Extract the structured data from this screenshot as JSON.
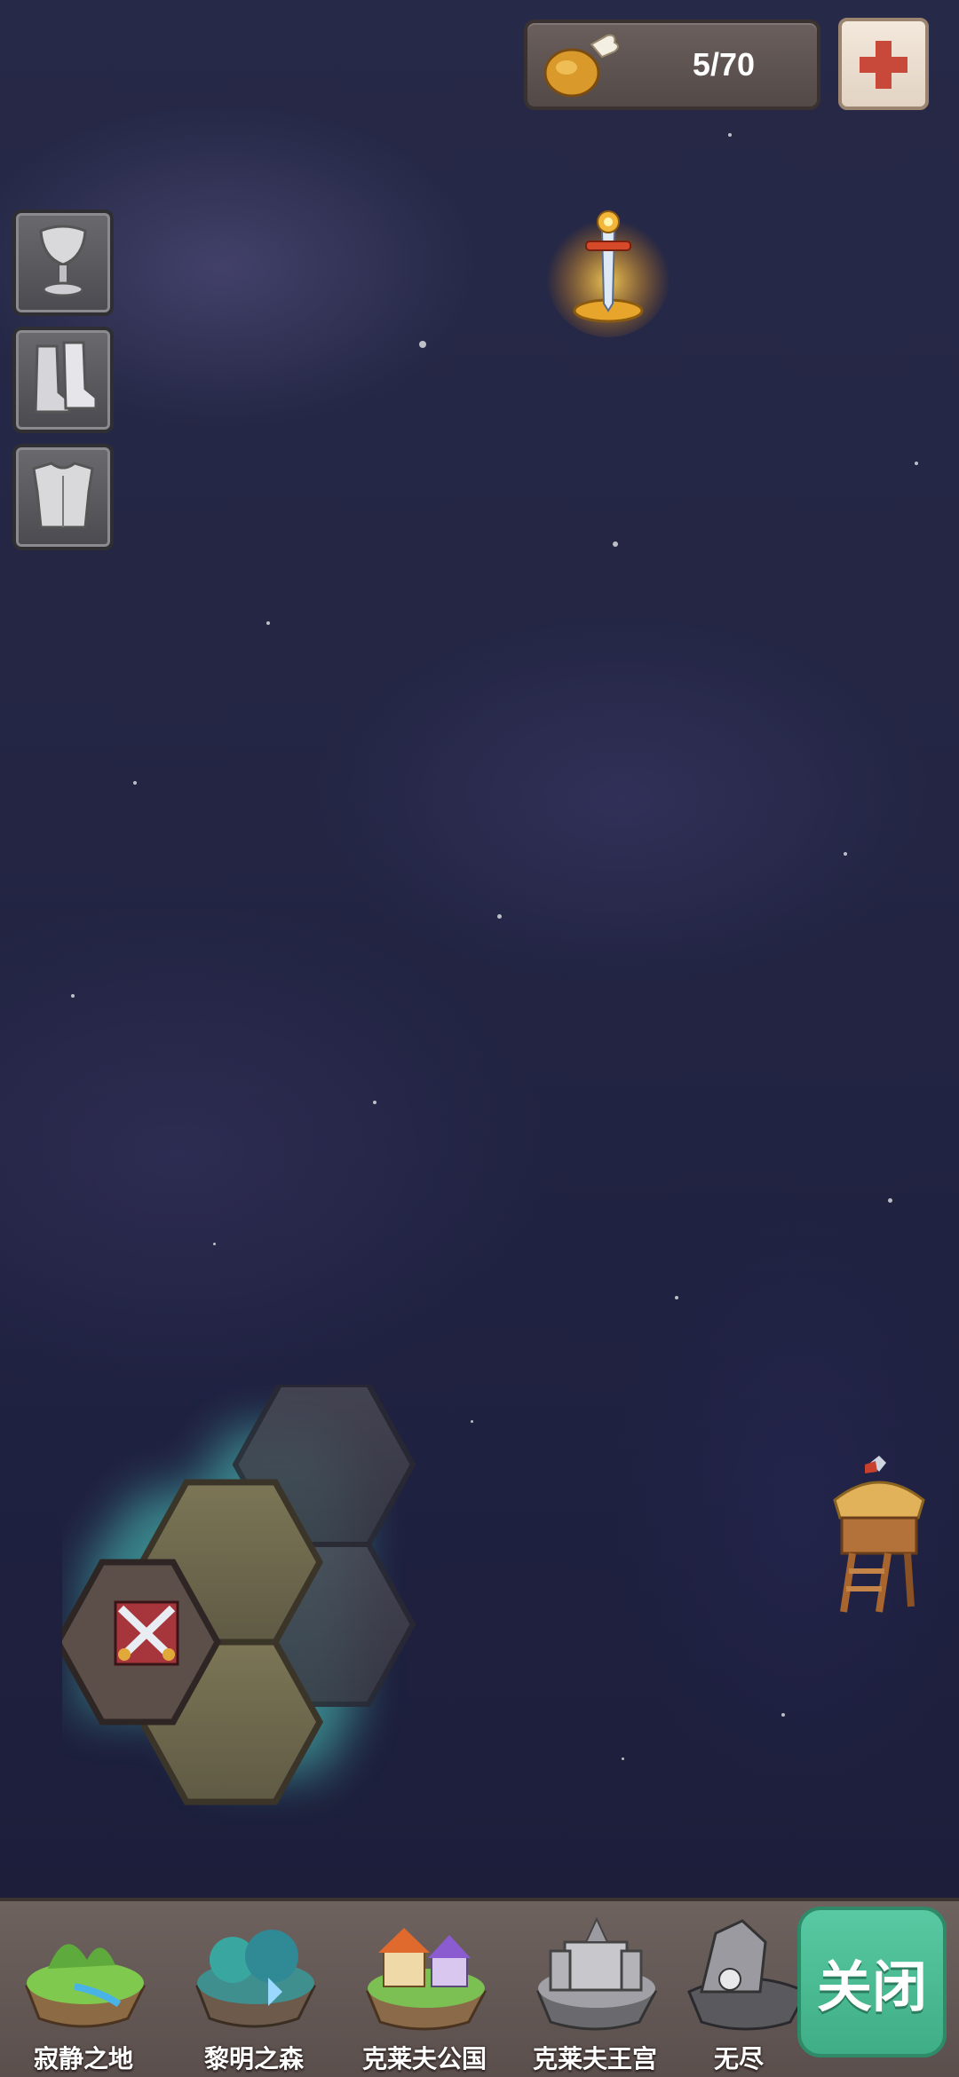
{
  "resources": {
    "stamina": "5/70",
    "stamina_icon": "meat-drumstick-icon",
    "add_icon": "plus-icon",
    "add_color": "#c8493a"
  },
  "equipment_slots": [
    {
      "icon": "goblet-icon"
    },
    {
      "icon": "boots-icon"
    },
    {
      "icon": "chestplate-icon"
    }
  ],
  "map": {
    "reward_icon": "golden-sword-trophy-icon",
    "tower_icon": "watchtower-icon",
    "battle_tile_icon": "crossed-swords-icon",
    "glow_color": "#4fd6c8"
  },
  "regions": [
    {
      "label": "寂静之地",
      "icon": "island-meadow-icon"
    },
    {
      "label": "黎明之森",
      "icon": "island-forest-icon"
    },
    {
      "label": "克莱夫公国",
      "icon": "island-village-icon"
    },
    {
      "label": "克莱夫王宫",
      "icon": "island-castle-icon"
    },
    {
      "label": "无尽",
      "icon": "island-rock-icon"
    }
  ],
  "close_label": "关闭",
  "close_color": "#4fc099"
}
